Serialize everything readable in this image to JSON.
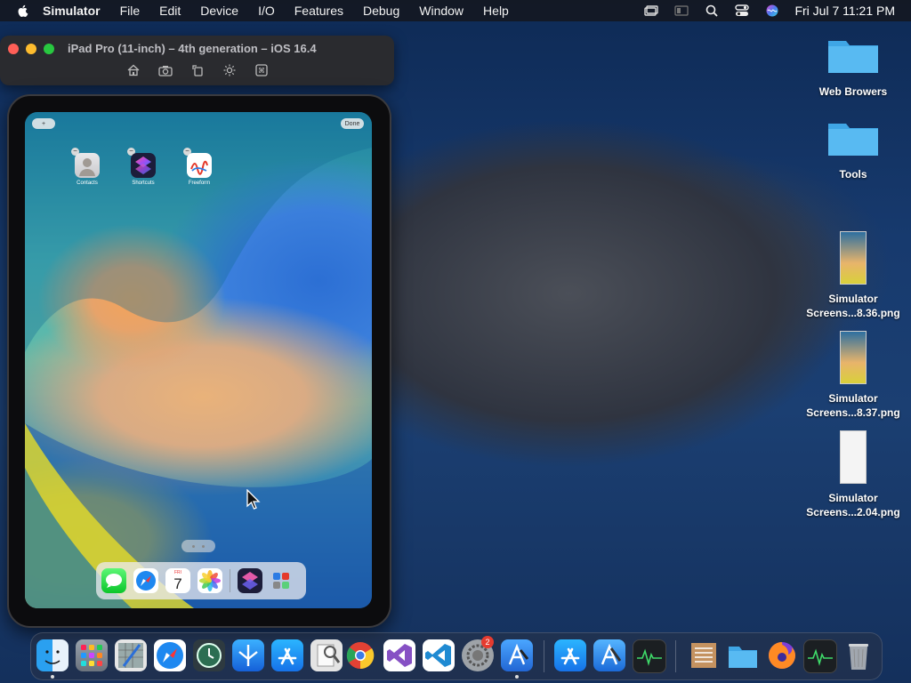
{
  "menubar": {
    "app_name": "Simulator",
    "items": [
      "File",
      "Edit",
      "Device",
      "I/O",
      "Features",
      "Debug",
      "Window",
      "Help"
    ],
    "clock": "Fri Jul 7  11:21 PM"
  },
  "simulator": {
    "title": "iPad Pro (11-inch) – 4th generation – iOS 16.4",
    "tools": [
      "home-icon",
      "screenshot-icon",
      "rotate-icon",
      "appearance-icon",
      "keyboard-shortcut-icon"
    ]
  },
  "ipad": {
    "add_button": "+",
    "done_button": "Done",
    "apps": [
      {
        "label": "Contacts"
      },
      {
        "label": "Shortcuts"
      },
      {
        "label": "Freeform"
      }
    ],
    "dock_apps": [
      "Messages",
      "Safari",
      "Calendar",
      "Photos",
      "Shortcuts",
      "Recent apps"
    ],
    "calendar_day": "FRI",
    "calendar_date": "7"
  },
  "desktop": {
    "icons": [
      {
        "label": "Web Browers"
      },
      {
        "label": "Tools"
      },
      {
        "label_line1": "Simulator",
        "label_line2": "Screens...8.36.png"
      },
      {
        "label_line1": "Simulator",
        "label_line2": "Screens...8.37.png"
      },
      {
        "label_line1": "Simulator",
        "label_line2": "Screens...2.04.png"
      }
    ]
  },
  "dock": {
    "apps": [
      "Finder",
      "Launchpad",
      "Xcode Instruments",
      "Safari",
      "Time Machine",
      "Testflight",
      "App Store",
      "Preview",
      "Chrome",
      "Visual Studio",
      "VS Code",
      "System Settings",
      "Simulator",
      "App Store",
      "Xcode",
      "Activity Monitor",
      "Archive",
      "Folder",
      "Firefox",
      "Activity Monitor",
      "Trash"
    ],
    "settings_badge": "2"
  }
}
